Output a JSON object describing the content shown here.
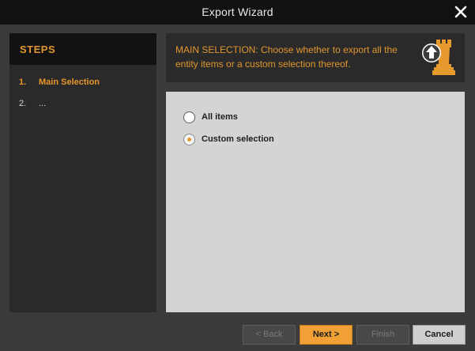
{
  "window": {
    "title": "Export Wizard"
  },
  "steps": {
    "header": "STEPS",
    "items": [
      {
        "number": "1.",
        "label": "Main Selection",
        "active": true
      },
      {
        "number": "2.",
        "label": "...",
        "active": false
      }
    ]
  },
  "info": {
    "text": "MAIN SELECTION: Choose whether to export all the entity items or a custom selection thereof."
  },
  "options": [
    {
      "label": "All items",
      "checked": false
    },
    {
      "label": "Custom selection",
      "checked": true
    }
  ],
  "buttons": {
    "back": "< Back",
    "next": "Next >",
    "finish": "Finish",
    "cancel": "Cancel"
  },
  "colors": {
    "accent": "#e0962f",
    "titlebar": "#121212",
    "background": "#3c3b3b",
    "panel": "#2b2a2a",
    "content": "#d4d4d4"
  },
  "icons": {
    "close": "close-icon",
    "wizard": "chess-rook-upload-icon"
  }
}
